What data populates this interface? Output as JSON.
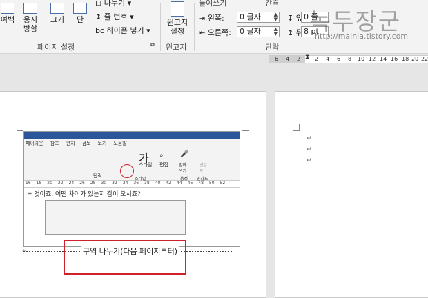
{
  "ribbon": {
    "margins_label": "여백",
    "orientation_label": "용지\n방향",
    "size_label": "크기",
    "columns_label": "단",
    "breaks_label": "나누기",
    "line_numbers_label": "줄 번호",
    "hyphenation_label": "하이픈 넣기",
    "page_setup_group": "페이지 설정",
    "manuscript_label": "원고지\n설정",
    "manuscript_group": "원고지",
    "indent_header": "들여쓰기",
    "spacing_header": "간격",
    "indent_left_label": "왼쪽:",
    "indent_right_label": "오른쪽:",
    "indent_left_value": "0 글자",
    "indent_right_value": "0 글자",
    "spacing_before_label": "앞:",
    "spacing_after_label": "뒤:",
    "spacing_before_value": "0 줄",
    "spacing_after_value": "8 pt",
    "paragraph_group": "단락"
  },
  "watermark": {
    "title": "녹두장군",
    "url": "http://mainia.tistory.com"
  },
  "ruler": {
    "ticks": [
      "6",
      "4",
      "2",
      "",
      "2",
      "4",
      "6",
      "8",
      "10",
      "12",
      "14",
      "16",
      "18",
      "20",
      "22"
    ]
  },
  "embedded": {
    "tabs": [
      "페이아웃",
      "참조",
      "편지",
      "검토",
      "보기",
      "도움말"
    ],
    "ruler_ticks": [
      "16",
      "18",
      "20",
      "22",
      "24",
      "26",
      "28",
      "30",
      "32",
      "34",
      "36",
      "38",
      "40",
      "42",
      "44",
      "46",
      "48",
      "50",
      "52"
    ],
    "ribbon_labels": [
      "단락",
      "스타일",
      "편집",
      "받아\n쓰기",
      "민감\n도",
      "음성",
      "민감도",
      "스타일"
    ],
    "body_text": "= 것이죠. 어떤 차이가 있는지 감이 오시죠?"
  },
  "document": {
    "section_break_label": "구역 나누기(다음 페이지부터)"
  }
}
